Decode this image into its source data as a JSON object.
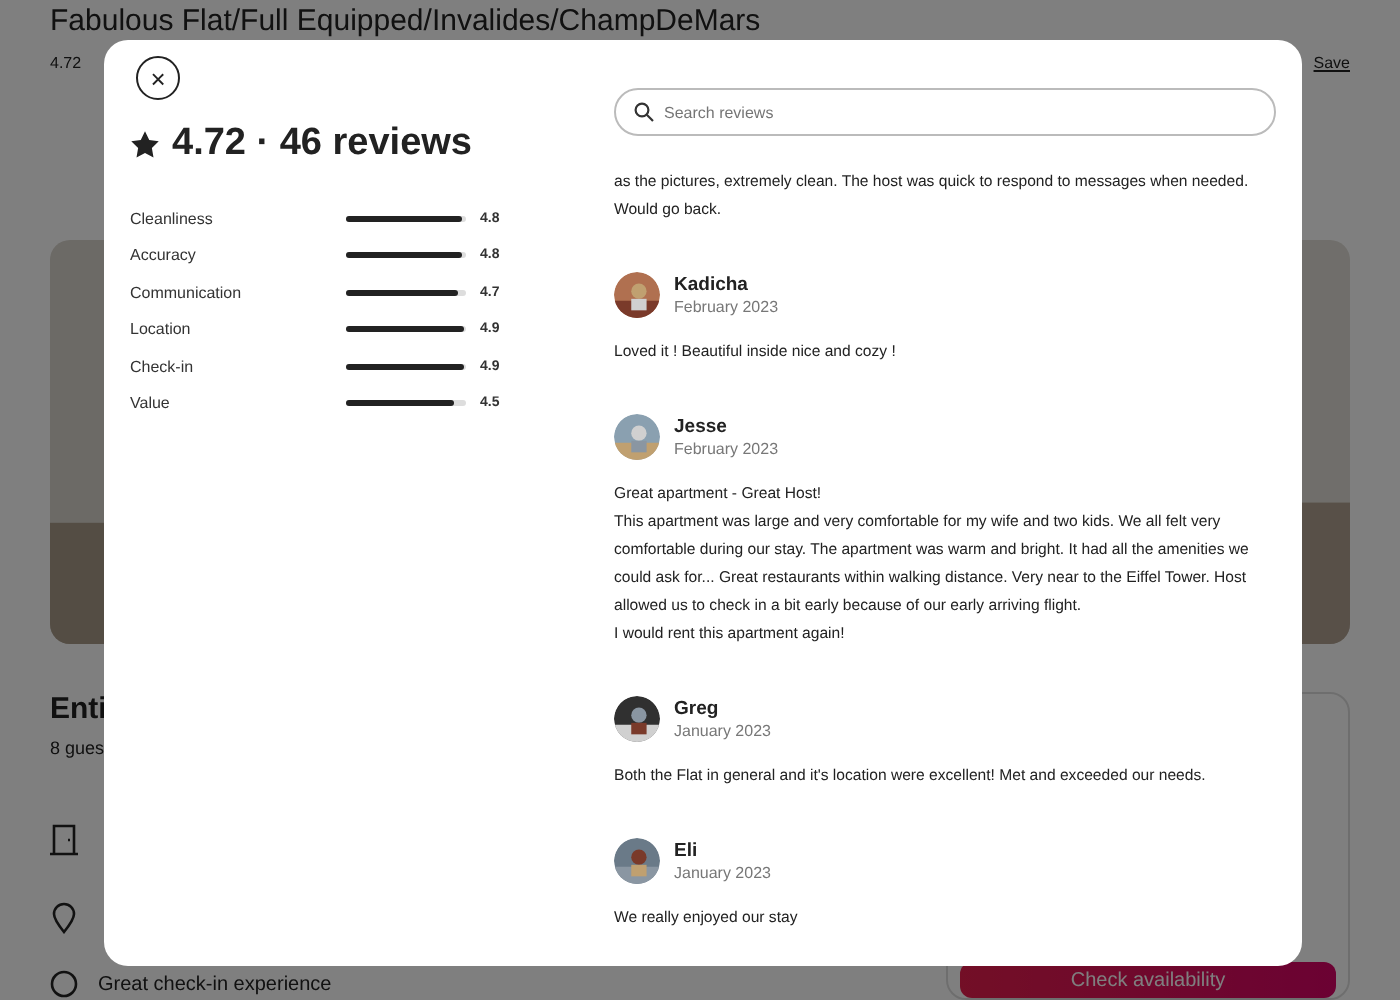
{
  "listing": {
    "title": "Fabulous Flat/Full Equipped/Invalides/ChampDeMars",
    "rating": "4.72",
    "save": "Save",
    "heading": "Enti",
    "guests": "8 gues",
    "highlight": "Great check-in experience",
    "cta": "Check availability"
  },
  "modal": {
    "close": "×",
    "summary": "4.72 · 46 reviews",
    "categories": [
      {
        "name": "Cleanliness",
        "level": 0.96,
        "value": "4.8"
      },
      {
        "name": "Accuracy",
        "level": 0.96,
        "value": "4.8"
      },
      {
        "name": "Communication",
        "level": 0.94,
        "value": "4.7"
      },
      {
        "name": "Location",
        "level": 0.98,
        "value": "4.9"
      },
      {
        "name": "Check-in",
        "level": 0.98,
        "value": "4.9"
      },
      {
        "name": "Value",
        "level": 0.9,
        "value": "4.5"
      }
    ],
    "search": {
      "placeholder": "Search reviews"
    },
    "reviews": [
      {
        "lines": [
          "as the pictures, extremely clean. The host was quick to respond to messages when needed. Would go back."
        ]
      },
      {
        "name": "Kadicha",
        "date": "February 2023",
        "lines": [
          "Loved it ! Beautiful inside nice and cozy !"
        ]
      },
      {
        "name": "Jesse",
        "date": "February 2023",
        "lines": [
          "Great apartment - Great Host!",
          "This apartment was large and very comfortable for my wife and two kids. We all felt very comfortable during our stay. The apartment was warm and bright. It had all the amenities we could ask for... Great restaurants within walking distance. Very near to the Eiffel Tower. Host allowed us to check in a bit early because of our early arriving flight.",
          "I would rent this apartment again!"
        ]
      },
      {
        "name": "Greg",
        "date": "January 2023",
        "lines": [
          "Both the Flat in general and it's location were excellent! Met and exceeded our needs."
        ]
      },
      {
        "name": "Eli",
        "date": "January 2023",
        "lines": [
          "We really enjoyed our stay"
        ]
      }
    ]
  }
}
